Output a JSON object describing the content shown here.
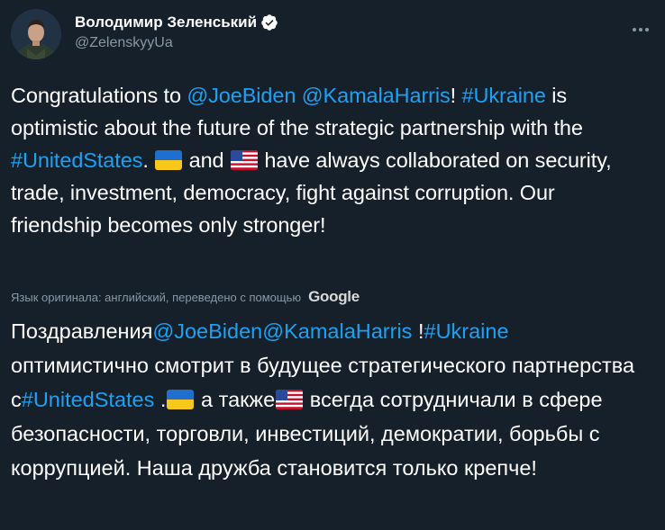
{
  "author": {
    "display_name": "Володимир Зеленський",
    "handle": "@ZelenskyyUa",
    "verified_icon": "verified-badge-icon"
  },
  "menu": {
    "icon": "more-options-icon"
  },
  "tweet": {
    "intro": "Congratulations to",
    "mention_biden": "@JoeBiden",
    "mention_harris": "@KamalaHarris",
    "after_mentions": "!",
    "hashtag_ukraine": "#Ukraine",
    "middle": " is optimistic about the future of the strategic partnership with the ",
    "hashtag_us": "#UnitedStates",
    "after_us": ". ",
    "flag_ua": "ukraine-flag-icon",
    "and": " and ",
    "flag_us": "us-flag-icon",
    "ending": " have always collaborated on security, trade, investment, democracy, fight against corruption. Our friendship becomes only stronger!"
  },
  "translation": {
    "note": "Язык оригинала: английский, переведено с помощью",
    "provider": "Google",
    "intro": "Поздравления",
    "mention_biden": "@JoeBiden",
    "mention_harris": "@KamalaHarris",
    "after_mentions": " !",
    "hashtag_ukraine": "#Ukraine",
    "middle": " оптимистично смотрит в будущее стратегического партнерства с",
    "hashtag_us": "#UnitedStates",
    "after_us": " .",
    "flag_ua": "ukraine-flag-icon",
    "and": " а также",
    "flag_us": "us-flag-icon",
    "ending": " всегда сотрудничали в сфере безопасности, торговли, инвестиций, демократии, борьбы с коррупцией. Наша дружба становится только крепче!"
  },
  "colors": {
    "background": "#15202b",
    "link": "#1da1f2",
    "secondary_text": "#8899a6",
    "primary_text": "#ffffff"
  }
}
